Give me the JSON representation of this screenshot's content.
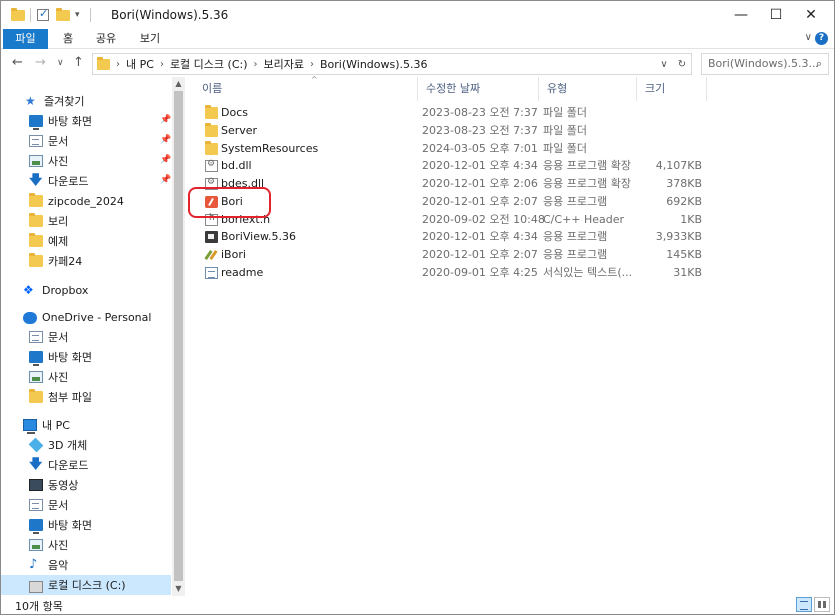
{
  "window": {
    "title": "Bori(Windows).5.36",
    "minimize_glyph": "—",
    "maximize_glyph": "☐",
    "close_glyph": "✕"
  },
  "ribbon": {
    "tabs": [
      {
        "label": "파일"
      },
      {
        "label": "홈"
      },
      {
        "label": "공유"
      },
      {
        "label": "보기"
      }
    ],
    "file_tab_color": "#1979ca"
  },
  "address": {
    "segments": [
      "내 PC",
      "로컬 디스크 (C:)",
      "보리자료",
      "Bori(Windows).5.36"
    ],
    "search_placeholder": "Bori(Windows).5.3..."
  },
  "nav": {
    "items": [
      {
        "label": "즐겨찾기",
        "icon": "star-icon"
      },
      {
        "label": "바탕 화면",
        "icon": "desktop-icon",
        "pinned": true
      },
      {
        "label": "문서",
        "icon": "document-icon",
        "pinned": true
      },
      {
        "label": "사진",
        "icon": "picture-icon",
        "pinned": true
      },
      {
        "label": "다운로드",
        "icon": "download-icon",
        "pinned": true
      },
      {
        "label": "zipcode_2024",
        "icon": "folder-icon"
      },
      {
        "label": "보리",
        "icon": "folder-icon"
      },
      {
        "label": "예제",
        "icon": "folder-icon"
      },
      {
        "label": "카페24",
        "icon": "folder-icon"
      },
      {
        "label": "Dropbox",
        "icon": "dropbox-icon"
      },
      {
        "label": "OneDrive - Personal",
        "icon": "onedrive-icon"
      },
      {
        "label": "문서",
        "icon": "document-icon"
      },
      {
        "label": "바탕 화면",
        "icon": "desktop-icon"
      },
      {
        "label": "사진",
        "icon": "picture-icon"
      },
      {
        "label": "첨부 파일",
        "icon": "folder-icon"
      },
      {
        "label": "내 PC",
        "icon": "pc-icon"
      },
      {
        "label": "3D 개체",
        "icon": "3d-objects-icon"
      },
      {
        "label": "다운로드",
        "icon": "download-icon"
      },
      {
        "label": "동영상",
        "icon": "video-icon"
      },
      {
        "label": "문서",
        "icon": "document-icon"
      },
      {
        "label": "바탕 화면",
        "icon": "desktop-icon"
      },
      {
        "label": "사진",
        "icon": "picture-icon"
      },
      {
        "label": "음악",
        "icon": "music-icon"
      },
      {
        "label": "로컬 디스크 (C:)",
        "icon": "drive-icon",
        "selected": true
      }
    ]
  },
  "columns": {
    "name": "이름",
    "date": "수정한 날짜",
    "type": "유형",
    "size": "크기"
  },
  "files": [
    {
      "name": "Docs",
      "date": "2023-08-23 오전 7:37",
      "type": "파일 폴더",
      "size": "",
      "icon": "folder-icon"
    },
    {
      "name": "Server",
      "date": "2023-08-23 오전 7:37",
      "type": "파일 폴더",
      "size": "",
      "icon": "folder-icon"
    },
    {
      "name": "SystemResources",
      "date": "2024-03-05 오후 7:01",
      "type": "파일 폴더",
      "size": "",
      "icon": "folder-icon"
    },
    {
      "name": "bd.dll",
      "date": "2020-12-01 오후 4:34",
      "type": "응용 프로그램 확장",
      "size": "4,107KB",
      "icon": "dll-icon"
    },
    {
      "name": "bdes.dll",
      "date": "2020-12-01 오후 2:06",
      "type": "응용 프로그램 확장",
      "size": "378KB",
      "icon": "dll-icon"
    },
    {
      "name": "Bori",
      "date": "2020-12-01 오후 2:07",
      "type": "응용 프로그램",
      "size": "692KB",
      "icon": "bori-app-icon",
      "highlighted": true
    },
    {
      "name": "boriext.h",
      "date": "2020-09-02 오전 10:48",
      "type": "C/C++ Header",
      "size": "1KB",
      "icon": "header-file-icon"
    },
    {
      "name": "BoriView.5.36",
      "date": "2020-12-01 오후 4:34",
      "type": "응용 프로그램",
      "size": "3,933KB",
      "icon": "boriview-app-icon"
    },
    {
      "name": "iBori",
      "date": "2020-12-01 오후 2:07",
      "type": "응용 프로그램",
      "size": "145KB",
      "icon": "ibori-app-icon"
    },
    {
      "name": "readme",
      "date": "2020-09-01 오후 4:25",
      "type": "서식있는 텍스트(...",
      "size": "31KB",
      "icon": "rich-text-icon"
    }
  ],
  "status": {
    "item_count": "10개 항목"
  },
  "colors": {
    "selection": "#cce8ff",
    "highlight_ring": "#e2232e",
    "accent": "#1979ca"
  }
}
